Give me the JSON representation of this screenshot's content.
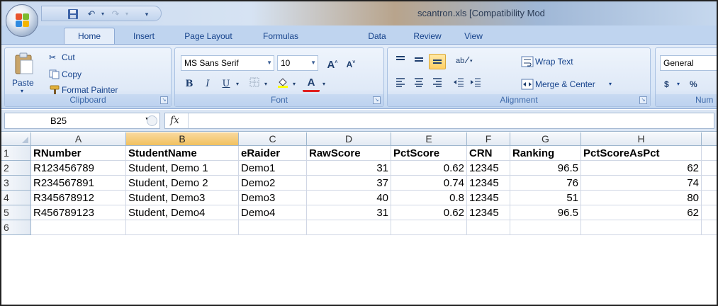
{
  "window": {
    "title": "scantron.xls  [Compatibility Mod"
  },
  "ribbon_tabs": [
    "Home",
    "Insert",
    "Page Layout",
    "Formulas",
    "Data",
    "Review",
    "View"
  ],
  "clipboard": {
    "paste": "Paste",
    "cut": "Cut",
    "copy": "Copy",
    "format_painter": "Format Painter",
    "label": "Clipboard"
  },
  "font": {
    "name": "MS Sans Serif",
    "size": "10",
    "label": "Font",
    "bold": "B",
    "italic": "I",
    "underline": "U",
    "grow": "A",
    "shrink": "A",
    "color_glyph": "A"
  },
  "alignment": {
    "wrap_text": "Wrap Text",
    "merge_center": "Merge & Center",
    "label": "Alignment"
  },
  "number": {
    "format": "General",
    "currency": "$",
    "percent": "%",
    "label": "Num"
  },
  "formula_bar": {
    "name_box": "B25",
    "fx": "fx",
    "formula": ""
  },
  "columns": [
    "A",
    "B",
    "C",
    "D",
    "E",
    "F",
    "G",
    "H"
  ],
  "selected_column": "B",
  "rows": [
    {
      "num": "1",
      "cells": [
        "RNumber",
        "StudentName",
        "eRaider",
        "RawScore",
        "PctScore",
        "CRN",
        "Ranking",
        "PctScoreAsPct"
      ]
    },
    {
      "num": "2",
      "cells": [
        "R123456789",
        "Student, Demo 1",
        "Demo1",
        "31",
        "0.62",
        "12345",
        "96.5",
        "62"
      ]
    },
    {
      "num": "3",
      "cells": [
        "R234567891",
        "Student, Demo 2",
        "Demo2",
        "37",
        "0.74",
        "12345",
        "76",
        "74"
      ]
    },
    {
      "num": "4",
      "cells": [
        "R345678912",
        "Student, Demo3",
        "Demo3",
        "40",
        "0.8",
        "12345",
        "51",
        "80"
      ]
    },
    {
      "num": "5",
      "cells": [
        "R456789123",
        "Student, Demo4",
        "Demo4",
        "31",
        "0.62",
        "12345",
        "96.5",
        "62"
      ]
    },
    {
      "num": "6",
      "cells": [
        "",
        "",
        "",
        "",
        "",
        "",
        "",
        ""
      ]
    }
  ]
}
